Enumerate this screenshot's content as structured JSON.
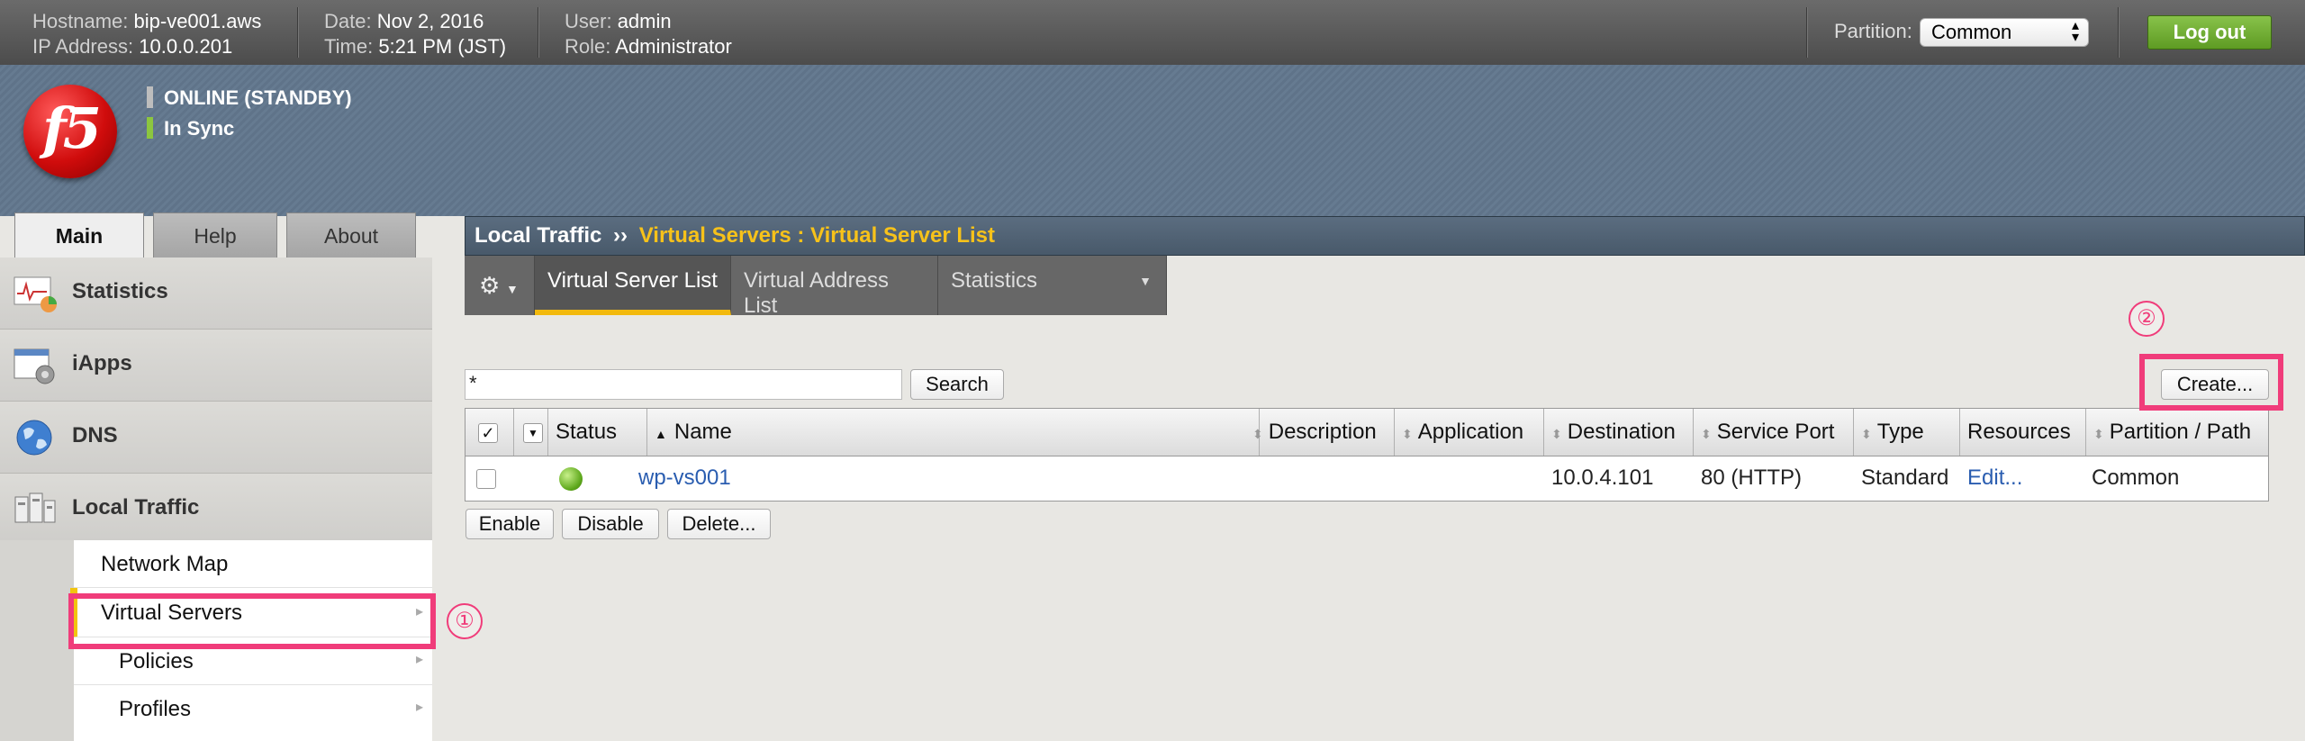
{
  "topbar": {
    "hostname_label": "Hostname:",
    "hostname": "bip-ve001.aws",
    "ip_label": "IP Address:",
    "ip": "10.0.0.201",
    "date_label": "Date:",
    "date": "Nov 2, 2016",
    "time_label": "Time:",
    "time": "5:21 PM (JST)",
    "user_label": "User:",
    "user": "admin",
    "role_label": "Role:",
    "role": "Administrator",
    "partition_label": "Partition:",
    "partition_value": "Common",
    "logout_label": "Log out"
  },
  "logo_text": "f5",
  "status": {
    "online": "ONLINE (STANDBY)",
    "sync": "In Sync",
    "online_color": "#bdbdbd",
    "sync_color": "#8cc63f"
  },
  "main_tabs": [
    {
      "label": "Main",
      "active": true
    },
    {
      "label": "Help",
      "active": false
    },
    {
      "label": "About",
      "active": false
    }
  ],
  "sidebar": {
    "items": [
      {
        "label": "Statistics",
        "icon": "statistics-icon"
      },
      {
        "label": "iApps",
        "icon": "iapps-icon"
      },
      {
        "label": "DNS",
        "icon": "globe-icon"
      },
      {
        "label": "Local Traffic",
        "icon": "local-traffic-icon"
      }
    ],
    "submenu": [
      {
        "label": "Network Map",
        "chevron": false
      },
      {
        "label": "Virtual Servers",
        "chevron": true,
        "selected": true
      },
      {
        "label": "Policies",
        "chevron": true
      },
      {
        "label": "Profiles",
        "chevron": true
      }
    ],
    "chevron_glyph": "▸"
  },
  "breadcrumb": {
    "section": "Local Traffic",
    "separator": "››",
    "current": "Virtual Servers : Virtual Server List"
  },
  "subtabs": [
    {
      "label": "Virtual Server List",
      "active": true
    },
    {
      "label": "Virtual Address List",
      "active": false
    },
    {
      "label": "Statistics",
      "active": false
    }
  ],
  "filter": {
    "value": "*",
    "search_label": "Search"
  },
  "create_label": "Create...",
  "table": {
    "headers": [
      "Status",
      "Name",
      "Description",
      "Application",
      "Destination",
      "Service Port",
      "Type",
      "Resources",
      "Partition / Path"
    ],
    "rows": [
      {
        "status": "available",
        "name": "wp-vs001",
        "description": "",
        "application": "",
        "destination": "10.0.4.101",
        "service_port": "80 (HTTP)",
        "type": "Standard",
        "resources": "Edit...",
        "partition": "Common"
      }
    ]
  },
  "actions": {
    "enable": "Enable",
    "disable": "Disable",
    "delete": "Delete..."
  },
  "annotations": {
    "one": "①",
    "two": "②",
    "color": "#f03c7a"
  }
}
